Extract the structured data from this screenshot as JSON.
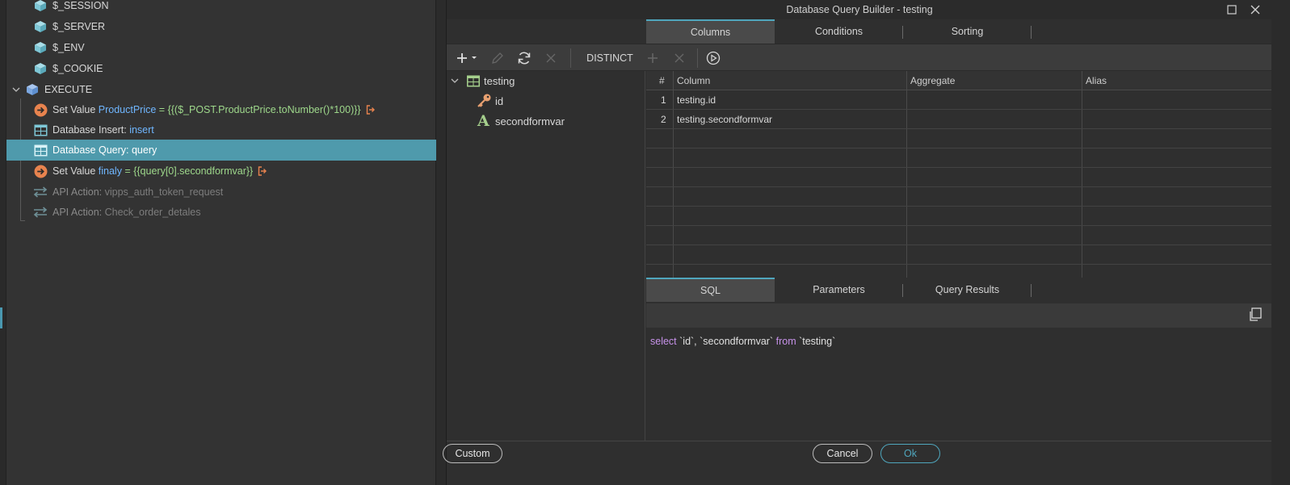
{
  "tree": {
    "items": [
      {
        "label": "$_SESSION",
        "icon": "cube-icon"
      },
      {
        "label": "$_SERVER",
        "icon": "cube-icon"
      },
      {
        "label": "$_ENV",
        "icon": "cube-icon"
      },
      {
        "label": "$_COOKIE",
        "icon": "cube-icon"
      },
      {
        "label": "EXECUTE",
        "icon": "cube-icon"
      }
    ],
    "actions": [
      {
        "prefix": "Set Value ",
        "name": "ProductPrice",
        "expr": " = {{($_POST.ProductPrice.toNumber()*100)}}"
      },
      {
        "prefix": "Database Insert: ",
        "name": "insert"
      },
      {
        "prefix": "Database Query: ",
        "name": "query"
      },
      {
        "prefix": "Set Value ",
        "name": "finaly",
        "expr": " = {{query[0].secondformvar}}"
      },
      {
        "prefix": "API Action: ",
        "name": "vipps_auth_token_request"
      },
      {
        "prefix": "API Action: ",
        "name": "Check_order_detales"
      }
    ]
  },
  "dialog": {
    "title": "Database Query Builder - testing",
    "tabs": [
      "Columns",
      "Conditions",
      "Sorting"
    ],
    "toolbar": {
      "distinct": "DISTINCT"
    },
    "table": {
      "name": "testing",
      "fields": [
        "id",
        "secondformvar"
      ]
    },
    "grid": {
      "headers": [
        "#",
        "Column",
        "Aggregate",
        "Alias"
      ],
      "rows": [
        {
          "num": "1",
          "column": "testing.id",
          "aggregate": "",
          "alias": ""
        },
        {
          "num": "2",
          "column": "testing.secondformvar",
          "aggregate": "",
          "alias": ""
        }
      ]
    },
    "bottom_tabs": [
      "SQL",
      "Parameters",
      "Query Results"
    ],
    "sql": {
      "kw1": "select",
      "cols": " `id`, `secondformvar` ",
      "kw2": "from",
      "tbl": " `testing`"
    },
    "buttons": {
      "custom": "Custom",
      "cancel": "Cancel",
      "ok": "Ok"
    }
  },
  "colors": {
    "accent": "#4fa6bd",
    "selected_row": "#4f9aac",
    "orange": "#e8834e",
    "cube": "#7ec7d6"
  }
}
